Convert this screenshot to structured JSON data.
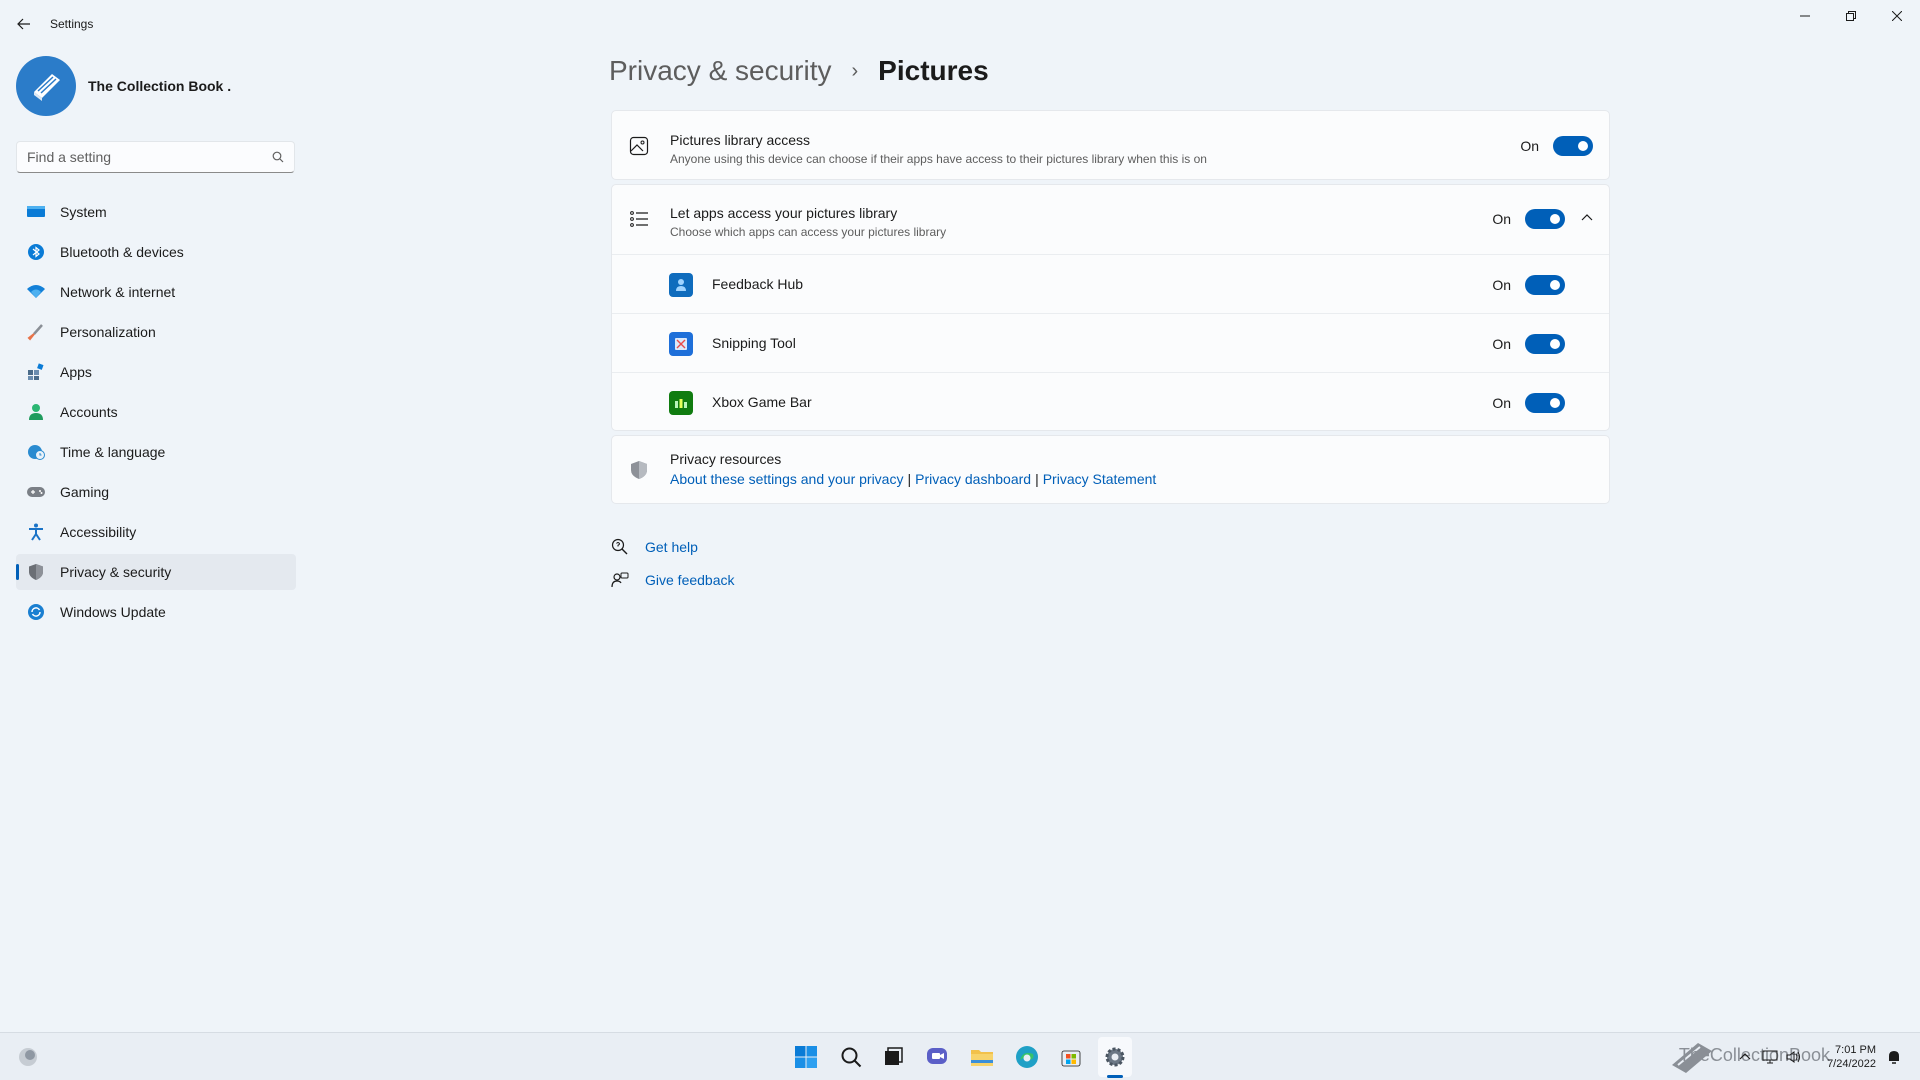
{
  "window": {
    "title": "Settings",
    "minimize_icon": "minimize-icon",
    "restore_icon": "restore-icon",
    "close_icon": "close-icon"
  },
  "profile": {
    "name": "The Collection Book ."
  },
  "search": {
    "placeholder": "Find a setting"
  },
  "sidebar": {
    "items": [
      {
        "label": "System",
        "icon": "monitor-icon",
        "color": "#0078d4"
      },
      {
        "label": "Bluetooth & devices",
        "icon": "bluetooth-icon",
        "color": "#0078d4"
      },
      {
        "label": "Network & internet",
        "icon": "wifi-icon",
        "color": "#0078d4"
      },
      {
        "label": "Personalization",
        "icon": "brush-icon",
        "color": "#e8734a"
      },
      {
        "label": "Apps",
        "icon": "apps-icon",
        "color": "#4a6b8a"
      },
      {
        "label": "Accounts",
        "icon": "person-icon",
        "color": "#2bb673"
      },
      {
        "label": "Time & language",
        "icon": "globe-clock-icon",
        "color": "#2a8bd0"
      },
      {
        "label": "Gaming",
        "icon": "gamepad-icon",
        "color": "#7a7a7a"
      },
      {
        "label": "Accessibility",
        "icon": "accessibility-icon",
        "color": "#1a73c7"
      },
      {
        "label": "Privacy & security",
        "icon": "shield-icon",
        "color": "#6b6f75",
        "active": true
      },
      {
        "label": "Windows Update",
        "icon": "refresh-icon",
        "color": "#1a7fd1"
      }
    ]
  },
  "breadcrumb": {
    "parent": "Privacy & security",
    "separator": "›",
    "current": "Pictures"
  },
  "library_access": {
    "title": "Pictures library access",
    "description": "Anyone using this device can choose if their apps have access to their pictures library when this is on",
    "toggle_label": "On",
    "enabled": true
  },
  "let_apps": {
    "title": "Let apps access your pictures library",
    "description": "Choose which apps can access your pictures library",
    "toggle_label": "On",
    "enabled": true,
    "expanded": true
  },
  "apps": [
    {
      "name": "Feedback Hub",
      "toggle_label": "On",
      "enabled": true,
      "icon": "feedback-hub-icon",
      "color": "#0f6cbd"
    },
    {
      "name": "Snipping Tool",
      "toggle_label": "On",
      "enabled": true,
      "icon": "snipping-tool-icon",
      "color": "#1e6fd9"
    },
    {
      "name": "Xbox Game Bar",
      "toggle_label": "On",
      "enabled": true,
      "icon": "xbox-game-bar-icon",
      "color": "#107c10"
    }
  ],
  "privacy_resources": {
    "title": "Privacy resources",
    "link1": "About these settings and your privacy",
    "link2": "Privacy dashboard",
    "link3": "Privacy Statement",
    "separator": "|"
  },
  "help": {
    "get_help": "Get help",
    "give_feedback": "Give feedback"
  },
  "taskbar": {
    "time": "7:01 PM",
    "date": "7/24/2022",
    "watermark": "TheCollectionBook",
    "accent": "#005fb8"
  }
}
